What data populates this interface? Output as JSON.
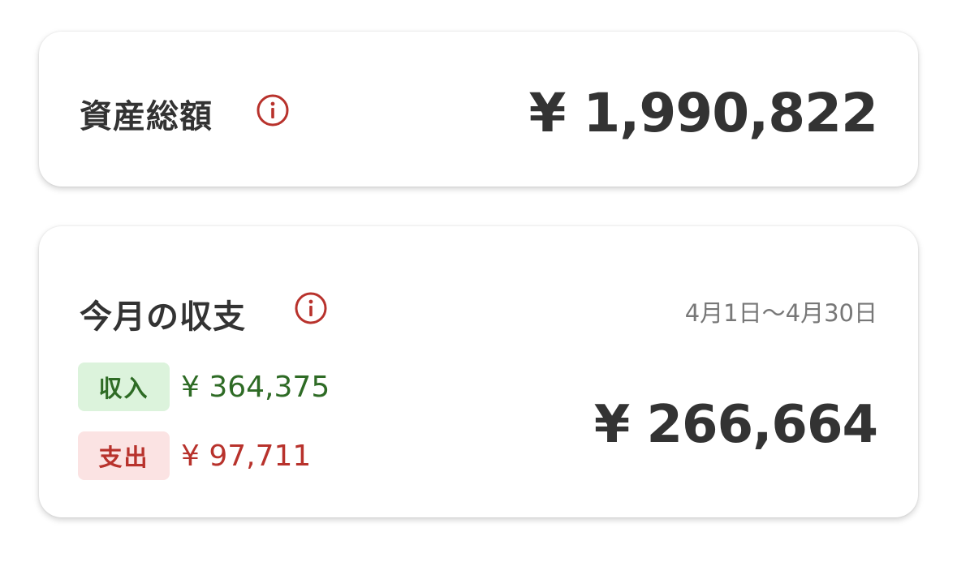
{
  "total_assets": {
    "title": "資産総額",
    "amount": "¥ 1,990,822",
    "info_icon": "info-circle-icon"
  },
  "monthly_balance": {
    "title": "今月の収支",
    "info_icon": "info-circle-icon",
    "period": "4月1日〜4月30日",
    "income_label": "収入",
    "income_amount": "¥ 364,375",
    "expense_label": "支出",
    "expense_amount": "¥ 97,711",
    "balance": "¥ 266,664"
  },
  "colors": {
    "accent_red": "#b8322c",
    "income_green": "#2e6b25",
    "income_bg": "#dcf3dc",
    "expense_bg": "#fbe3e3",
    "text_dark": "#333333",
    "text_muted": "#777777"
  }
}
